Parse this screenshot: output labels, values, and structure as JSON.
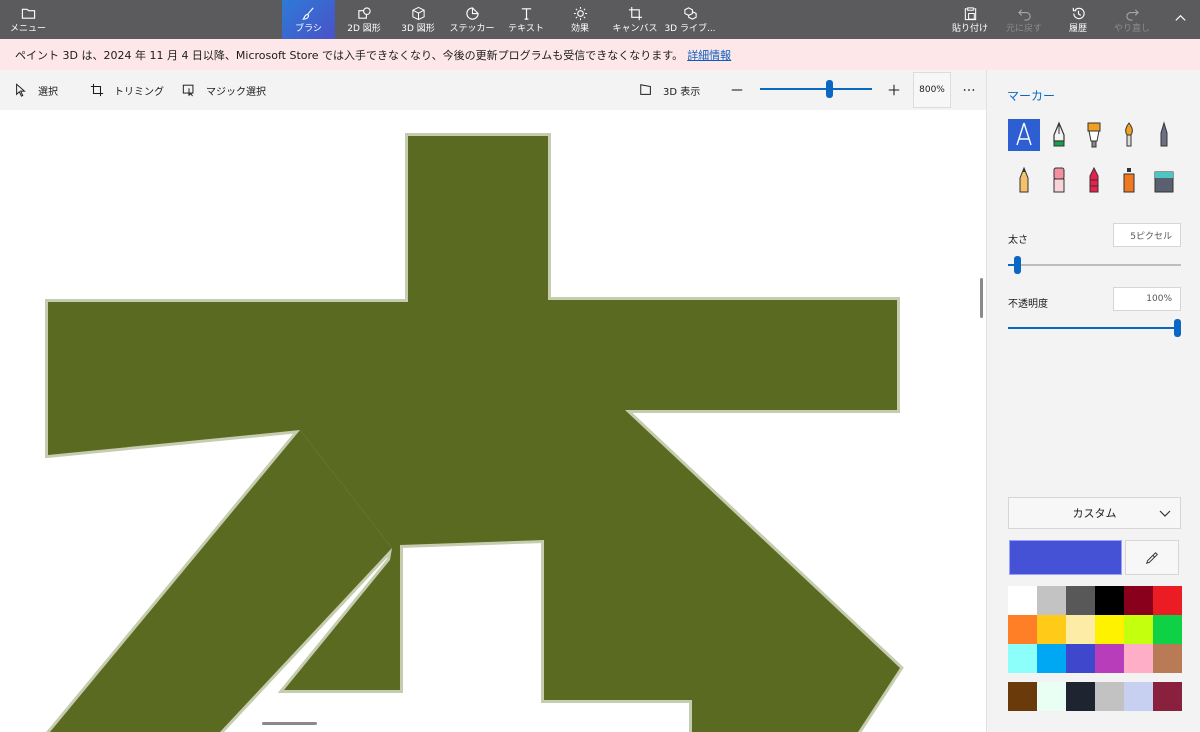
{
  "topbar": {
    "menu_label": "メニュー",
    "tabs": [
      {
        "label": "ブラシ",
        "icon": "brush-icon",
        "active": true
      },
      {
        "label": "2D 図形",
        "icon": "2d-shapes-icon"
      },
      {
        "label": "3D 図形",
        "icon": "3d-shapes-icon"
      },
      {
        "label": "ステッカー",
        "icon": "sticker-icon"
      },
      {
        "label": "テキスト",
        "icon": "text-icon"
      },
      {
        "label": "効果",
        "icon": "effects-icon"
      },
      {
        "label": "キャンバス",
        "icon": "canvas-icon"
      },
      {
        "label": "3D ライブ...",
        "icon": "3d-library-icon"
      }
    ],
    "actions": [
      {
        "label": "貼り付け",
        "icon": "paste-icon",
        "enabled": true
      },
      {
        "label": "元に戻す",
        "icon": "undo-icon",
        "enabled": false
      },
      {
        "label": "履歴",
        "icon": "history-icon",
        "enabled": true
      },
      {
        "label": "やり直し",
        "icon": "redo-icon",
        "enabled": false
      }
    ]
  },
  "notice": {
    "text": "ペイント 3D は、2024 年 11 月 4 日以降、Microsoft Store では入手できなくなり、今後の更新プログラムも受信できなくなります。",
    "link": "詳細情報"
  },
  "toolbar": {
    "select_label": "選択",
    "crop_label": "トリミング",
    "magic_select_label": "マジック選択",
    "view3d_label": "3D 表示",
    "zoom_value": "800%",
    "zoom_level_fraction": 0.62
  },
  "panel": {
    "title": "マーカー",
    "brushes": [
      "marker-icon",
      "calligraphy-pen-icon",
      "oil-brush-icon",
      "watercolor-icon",
      "pixel-pen-icon",
      "pencil-icon",
      "eraser-icon",
      "crayon-icon",
      "spray-can-icon",
      "fill-icon"
    ],
    "thickness_label": "太さ",
    "thickness_value": "5ピクセル",
    "thickness_fraction": 0.03,
    "opacity_label": "不透明度",
    "opacity_value": "100%",
    "opacity_fraction": 1.0,
    "color_mode": "カスタム",
    "current_color": "#4552d6",
    "palette": [
      "#ffffff",
      "#c3c3c3",
      "#585858",
      "#000000",
      "#88001b",
      "#ec1c24",
      "#ff7f27",
      "#ffca18",
      "#fdeca6",
      "#fff200",
      "#c4ff0e",
      "#0ed145",
      "#8cfffb",
      "#00a8f3",
      "#3f48cc",
      "#b83dba",
      "#ffaec8",
      "#b97a56"
    ],
    "custom_palette": [
      "#6b3a0a",
      "#eafff3",
      "#1f2530",
      "#c2c2c2",
      "#c8d0f2",
      "#88203e"
    ]
  },
  "canvas": {
    "ink_color": "#5a6b21",
    "edge_color": "#c6ccaf"
  }
}
